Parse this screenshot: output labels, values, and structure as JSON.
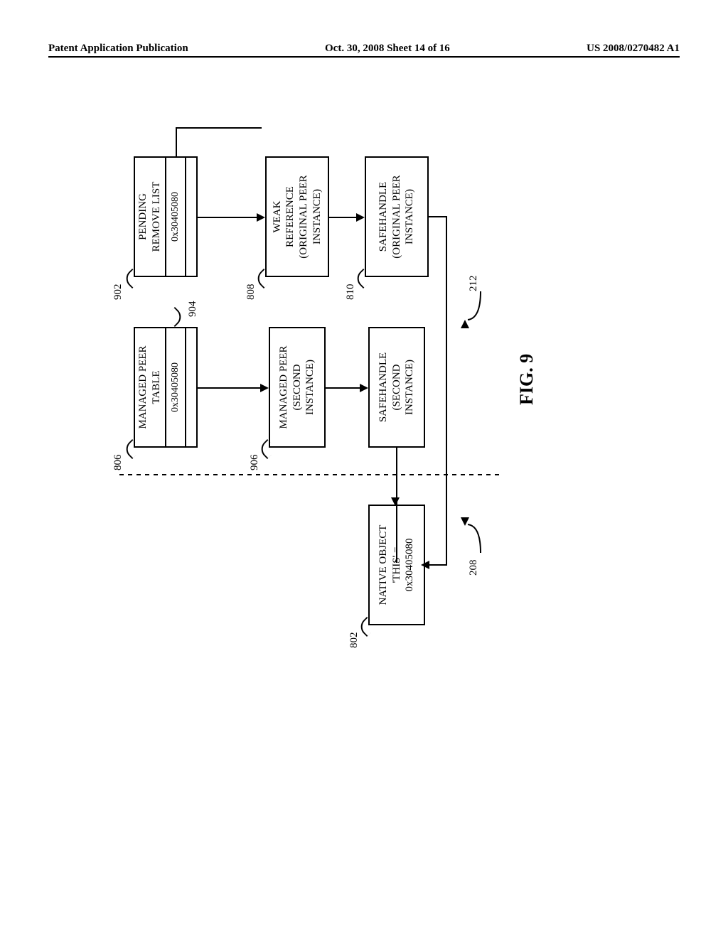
{
  "header": {
    "left": "Patent Application Publication",
    "mid": "Oct. 30, 2008  Sheet 14 of 16",
    "right": "US 2008/0270482 A1"
  },
  "figure_label": "FIG. 9",
  "refs": {
    "r806": "806",
    "r902": "902",
    "r904": "904",
    "r808": "808",
    "r906": "906",
    "r810": "810",
    "r802": "802",
    "r208": "208",
    "r212": "212"
  },
  "boxes": {
    "managed_peer_table": "MANAGED PEER\nTABLE",
    "managed_peer_table_entry": "0x30405080",
    "pending_remove_list": "PENDING\nREMOVE LIST",
    "pending_remove_entry": "0x30405080",
    "managed_peer_second": "MANAGED PEER\n(SECOND\nINSTANCE)",
    "weak_reference": "WEAK\nREFERENCE\n(ORIGINAL PEER\nINSTANCE)",
    "safehandle_second": "SAFEHANDLE\n(SECOND\nINSTANCE)",
    "safehandle_original": "SAFEHANDLE\n(ORIGINAL PEER\nINSTANCE)",
    "native_object": "NATIVE OBJECT\n'THIS' =\n0x30405080"
  }
}
